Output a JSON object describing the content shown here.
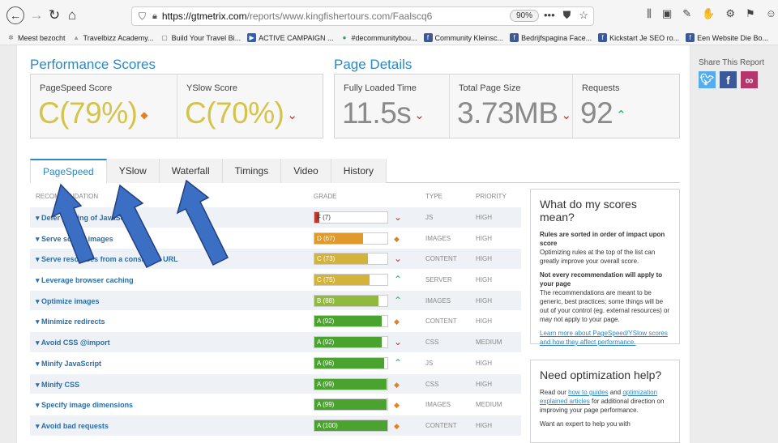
{
  "browser": {
    "url_domain": "https://gtmetrix.com",
    "url_path": "/reports/www.kingfishertours.com/Faalscq6",
    "zoom": "90%",
    "more": "•••"
  },
  "bookmarks": [
    {
      "label": "Meest bezocht",
      "icon": "gear-icon",
      "color": "#666666"
    },
    {
      "label": "Travelbizz Academy...",
      "icon": "triangle-icon",
      "color": "#9a9a9a"
    },
    {
      "label": "Build Your Travel Bi...",
      "icon": "page-icon",
      "color": "#666666"
    },
    {
      "label": "ACTIVE CAMPAIGN ...",
      "icon": "arrow-icon",
      "color": "#2f5fb3"
    },
    {
      "label": "#decommunitybou...",
      "icon": "circle-icon",
      "color": "#2e9b57"
    },
    {
      "label": "Community Kleinsc...",
      "icon": "facebook-icon",
      "color": "#3b5998"
    },
    {
      "label": "Bedrijfspagina Face...",
      "icon": "facebook-icon",
      "color": "#3b5998"
    },
    {
      "label": "Kickstart Je SEO ro...",
      "icon": "facebook-icon",
      "color": "#3b5998"
    },
    {
      "label": "Een Website Die Bo...",
      "icon": "facebook-icon",
      "color": "#3b5998"
    }
  ],
  "performance": {
    "title": "Performance Scores",
    "pagespeed_label": "PageSpeed Score",
    "pagespeed_value": "C(79%)",
    "yslow_label": "YSlow Score",
    "yslow_value": "C(70%)"
  },
  "details": {
    "title": "Page Details",
    "load_label": "Fully Loaded Time",
    "load_value": "11.5s",
    "size_label": "Total Page Size",
    "size_value": "3.73MB",
    "requests_label": "Requests",
    "requests_value": "92"
  },
  "tabs": [
    "PageSpeed",
    "YSlow",
    "Waterfall",
    "Timings",
    "Video",
    "History"
  ],
  "table": {
    "col_recommendation": "RECOMMENDATION",
    "col_grade": "GRADE",
    "col_type": "TYPE",
    "col_priority": "PRIORITY",
    "rows": [
      {
        "name": "Defer parsing of JavaScript",
        "grade": "F (7)",
        "pct": 7,
        "color": "#c0392b",
        "trend": "down",
        "type": "JS",
        "priority": "HIGH"
      },
      {
        "name": "Serve scaled images",
        "grade": "D (67)",
        "pct": 67,
        "color": "#e09a2b",
        "trend": "same",
        "type": "IMAGES",
        "priority": "HIGH"
      },
      {
        "name": "Serve resources from a consistent URL",
        "grade": "C (73)",
        "pct": 73,
        "color": "#d4b33a",
        "trend": "down",
        "type": "CONTENT",
        "priority": "HIGH"
      },
      {
        "name": "Leverage browser caching",
        "grade": "C (75)",
        "pct": 75,
        "color": "#d4b33a",
        "trend": "up",
        "type": "SERVER",
        "priority": "HIGH"
      },
      {
        "name": "Optimize images",
        "grade": "B (88)",
        "pct": 88,
        "color": "#8fba3e",
        "trend": "up",
        "type": "IMAGES",
        "priority": "HIGH"
      },
      {
        "name": "Minimize redirects",
        "grade": "A (92)",
        "pct": 92,
        "color": "#4aa22f",
        "trend": "same",
        "type": "CONTENT",
        "priority": "HIGH"
      },
      {
        "name": "Avoid CSS @import",
        "grade": "A (92)",
        "pct": 92,
        "color": "#4aa22f",
        "trend": "down",
        "type": "CSS",
        "priority": "MEDIUM"
      },
      {
        "name": "Minify JavaScript",
        "grade": "A (96)",
        "pct": 96,
        "color": "#4aa22f",
        "trend": "up",
        "type": "JS",
        "priority": "HIGH"
      },
      {
        "name": "Minify CSS",
        "grade": "A (99)",
        "pct": 99,
        "color": "#4aa22f",
        "trend": "same",
        "type": "CSS",
        "priority": "HIGH"
      },
      {
        "name": "Specify image dimensions",
        "grade": "A (99)",
        "pct": 99,
        "color": "#4aa22f",
        "trend": "same",
        "type": "IMAGES",
        "priority": "MEDIUM"
      },
      {
        "name": "Avoid bad requests",
        "grade": "A (100)",
        "pct": 100,
        "color": "#4aa22f",
        "trend": "same",
        "type": "CONTENT",
        "priority": "HIGH"
      }
    ]
  },
  "scores_help": {
    "title": "What do my scores mean?",
    "p1_bold": "Rules are sorted in order of impact upon score",
    "p1": "Optimizing rules at the top of the list can greatly improve your overall score.",
    "p2_bold": "Not every recommendation will apply to your page",
    "p2": "The recommendations are meant to be generic, best practices; some things will be out of your control (eg. external resources) or may not apply to your page.",
    "link": "Learn more about PageSpeed/YSlow scores and how they affect performance."
  },
  "optimization_help": {
    "title": "Need optimization help?",
    "p1_a": "Read our",
    "p1_link1": "how to guides",
    "p1_b": "and",
    "p1_link2": "optimization explained articles",
    "p1_c": "for additional direction on improving your page performance.",
    "p2": "Want an expert to help you with"
  },
  "share": {
    "title": "Share This Report",
    "twitter_color": "#55acee",
    "facebook_color": "#3b5998",
    "link_color": "#b5366b"
  }
}
